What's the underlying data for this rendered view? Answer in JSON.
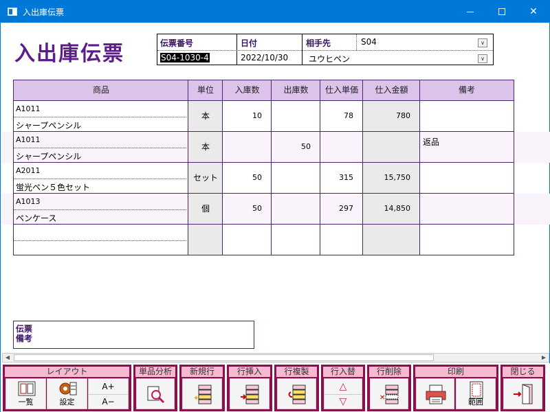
{
  "window": {
    "title": "入出庫伝票"
  },
  "doc_title": "入出庫伝票",
  "header": {
    "slip_no_label": "伝票番号",
    "slip_no_value": "S04-1030-4",
    "date_label": "日付",
    "date_value": "2022/10/30",
    "partner_label": "相手先",
    "partner_code": "S04",
    "partner_name": "ユウヒペン"
  },
  "grid": {
    "columns": [
      "商品",
      "単位",
      "入庫数",
      "出庫数",
      "仕入単価",
      "仕入金額",
      "備考"
    ],
    "rows": [
      {
        "code": "A1011",
        "name": "シャープペンシル",
        "unit": "本",
        "in_qty": "10",
        "out_qty": "",
        "unit_price": "78",
        "amount": "780",
        "note": ""
      },
      {
        "code": "A1011",
        "name": "シャープペンシル",
        "unit": "本",
        "in_qty": "",
        "out_qty": "50",
        "unit_price": "",
        "amount": "",
        "note": "返品"
      },
      {
        "code": "A2011",
        "name": "蛍光ペン５色セット",
        "unit": "セット",
        "in_qty": "50",
        "out_qty": "",
        "unit_price": "315",
        "amount": "15,750",
        "note": ""
      },
      {
        "code": "A1013",
        "name": "ペンケース",
        "unit": "個",
        "in_qty": "50",
        "out_qty": "",
        "unit_price": "297",
        "amount": "14,850",
        "note": ""
      },
      {
        "code": "",
        "name": "",
        "unit": "",
        "in_qty": "",
        "out_qty": "",
        "unit_price": "",
        "amount": "",
        "note": ""
      }
    ]
  },
  "memo": {
    "label_line1": "伝票",
    "label_line2": "備考"
  },
  "toolbar": {
    "layout_group": "レイアウト",
    "list_label": "一覧",
    "settings_label": "設定",
    "font_up": "A+",
    "font_down": "A−",
    "item_analysis": "単品分析",
    "new_row": "新規行",
    "insert_row": "行挿入",
    "copy_row": "行複製",
    "swap_row": "行入替",
    "delete_row": "行削除",
    "print_group": "印刷",
    "range_label": "範囲",
    "close": "閉じる"
  }
}
